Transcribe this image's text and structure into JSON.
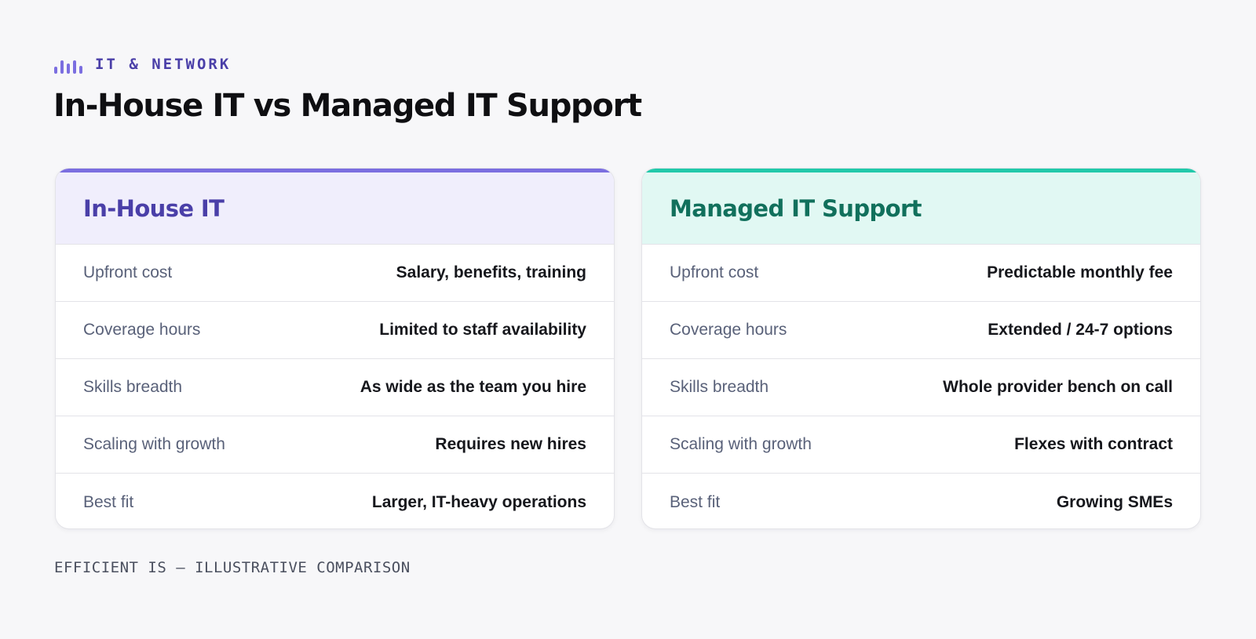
{
  "header": {
    "eyebrow": "IT & NETWORK",
    "eyebrow_icon": "signal-bars-icon",
    "title": "In-House IT vs Managed IT Support"
  },
  "colors": {
    "accent_purple": "#7b6ee0",
    "accent_teal": "#22c9aa",
    "purple_text": "#4a3fa8",
    "teal_text": "#11705c"
  },
  "cards": [
    {
      "title": "In-House IT",
      "rows": [
        {
          "label": "Upfront cost",
          "value": "Salary, benefits, training"
        },
        {
          "label": "Coverage hours",
          "value": "Limited to staff availability"
        },
        {
          "label": "Skills breadth",
          "value": "As wide as the team you hire"
        },
        {
          "label": "Scaling with growth",
          "value": "Requires new hires"
        },
        {
          "label": "Best fit",
          "value": "Larger, IT-heavy operations"
        }
      ]
    },
    {
      "title": "Managed IT Support",
      "rows": [
        {
          "label": "Upfront cost",
          "value": "Predictable monthly fee"
        },
        {
          "label": "Coverage hours",
          "value": "Extended / 24-7 options"
        },
        {
          "label": "Skills breadth",
          "value": "Whole provider bench on call"
        },
        {
          "label": "Scaling with growth",
          "value": "Flexes with contract"
        },
        {
          "label": "Best fit",
          "value": "Growing SMEs"
        }
      ]
    }
  ],
  "footer": "EFFICIENT IS — ILLUSTRATIVE COMPARISON"
}
